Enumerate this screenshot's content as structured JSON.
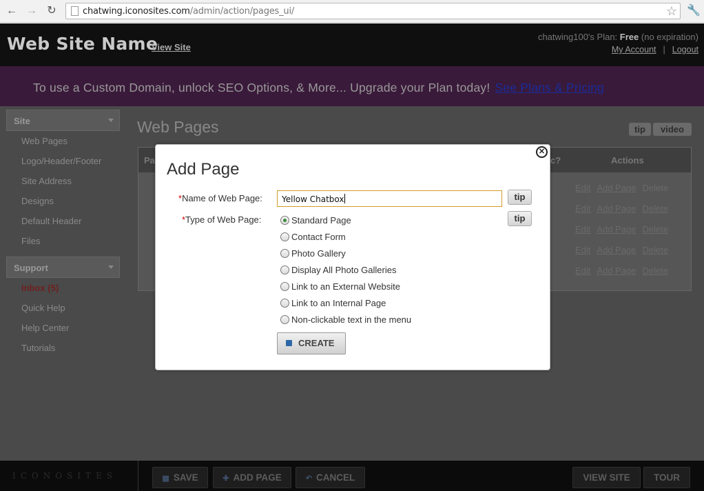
{
  "browser": {
    "url_host": "chatwing.iconosites.com",
    "url_path": "/admin/action/pages_ui/"
  },
  "header": {
    "site_name": "Web Site Name",
    "view_site": "View Site",
    "plan_prefix": "chatwing100's Plan:",
    "plan_name": "Free",
    "plan_suffix": "(no expiration)",
    "my_account": "My Account",
    "separator": "|",
    "logout": "Logout"
  },
  "banner": {
    "text": "To use a Custom Domain, unlock SEO Options, & More... Upgrade your Plan today!",
    "link": "See Plans & Pricing"
  },
  "sidebar": {
    "site_heading": "Site",
    "site_items": [
      {
        "label": "Web Pages"
      },
      {
        "label": "Logo/Header/Footer"
      },
      {
        "label": "Site Address"
      },
      {
        "label": "Designs"
      },
      {
        "label": "Default Header"
      },
      {
        "label": "Files"
      }
    ],
    "support_heading": "Support",
    "support_items": [
      {
        "label": "Inbox (5)"
      },
      {
        "label": "Quick Help"
      },
      {
        "label": "Help Center"
      },
      {
        "label": "Tutorials"
      }
    ]
  },
  "content": {
    "title": "Web Pages",
    "tip": "tip",
    "video": "video",
    "col_pa": "Pa",
    "col_c": "c?",
    "col_actions": "Actions",
    "action_edit": "Edit",
    "action_add": "Add Page",
    "action_delete": "Delete"
  },
  "modal": {
    "title": "Add Page",
    "name_label": "Name of Web Page:",
    "name_value": "Yellow Chatbox",
    "type_label": "Type of Web Page:",
    "required_mark": "*",
    "tip": "tip",
    "options": [
      {
        "label": "Standard Page"
      },
      {
        "label": "Contact Form"
      },
      {
        "label": "Photo Gallery"
      },
      {
        "label": "Display All Photo Galleries"
      },
      {
        "label": "Link to an External Website"
      },
      {
        "label": "Link to an Internal Page"
      },
      {
        "label": "Non-clickable text in the menu"
      }
    ],
    "selected_option": "Standard Page",
    "create": "CREATE"
  },
  "bottom_bar": {
    "logo": "ICONOSITES",
    "save": "SAVE",
    "add_page": "ADD PAGE",
    "cancel": "CANCEL",
    "view_site": "VIEW SITE",
    "tour": "TOUR"
  }
}
